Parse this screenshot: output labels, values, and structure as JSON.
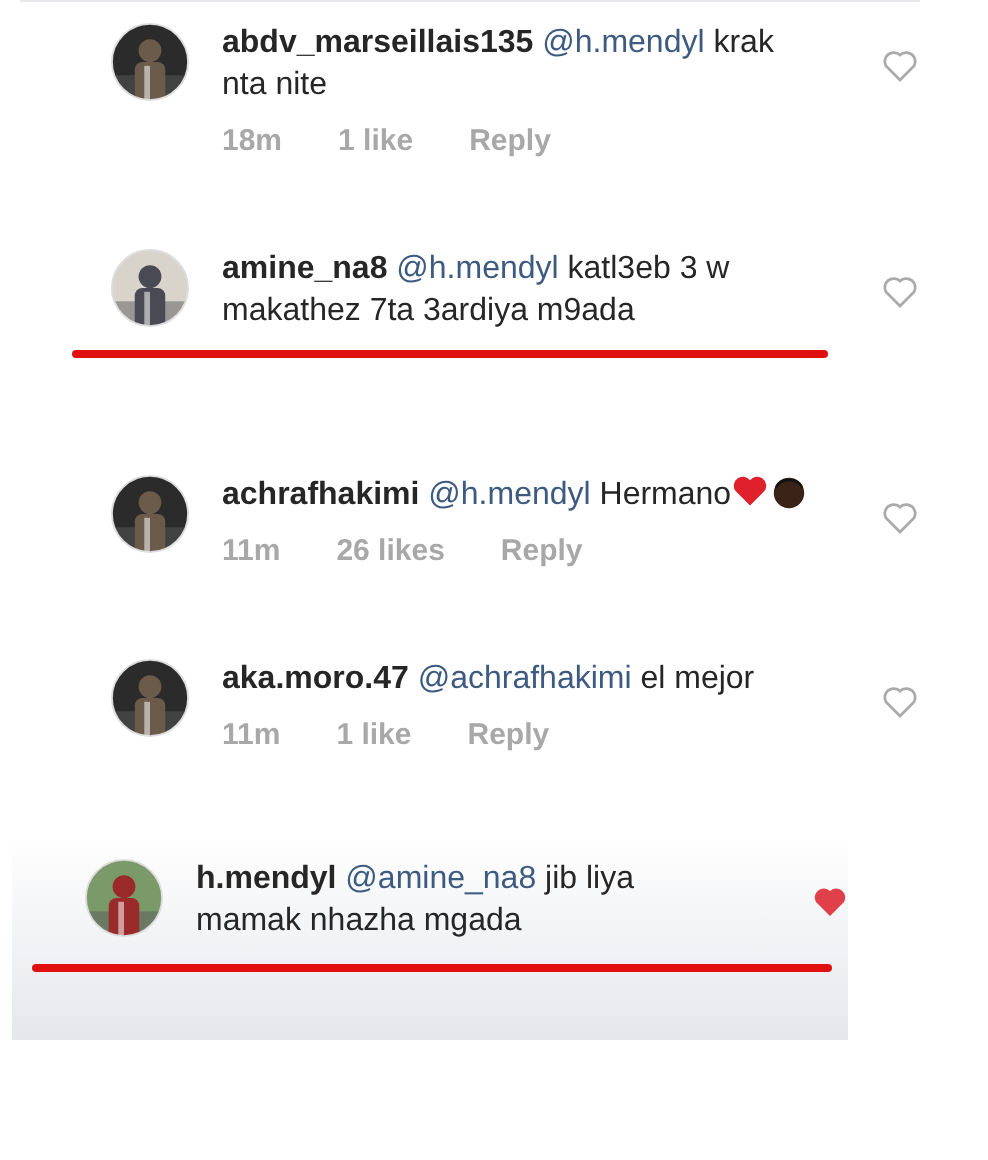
{
  "comments": [
    {
      "user": "abdv_marseillais135",
      "mention": "@h.mendyl",
      "text": "krak nta nite",
      "time": "18m",
      "likes": "1 like",
      "reply": "Reply",
      "liked": false,
      "highlighted": false,
      "marked": false
    },
    {
      "user": "amine_na8",
      "mention": "@h.mendyl",
      "text": "katl3eb 3 w makathez 7ta 3ardiya m9ada",
      "liked": false,
      "highlighted": false,
      "marked": true
    },
    {
      "user": "achrafhakimi",
      "mention": "@h.mendyl",
      "text": "Hermano",
      "emoji": [
        {
          "kind": "heart"
        },
        {
          "kind": "face"
        }
      ],
      "time": "11m",
      "likes": "26 likes",
      "reply": "Reply",
      "liked": false,
      "highlighted": false,
      "marked": false
    },
    {
      "user": "aka.moro.47",
      "mention": "@achrafhakimi",
      "text": "el mejor",
      "time": "11m",
      "likes": "1 like",
      "reply": "Reply",
      "liked": false,
      "highlighted": false,
      "marked": false
    },
    {
      "user": "h.mendyl",
      "mention": "@amine_na8",
      "text": "jib liya mamak nhazha mgada",
      "liked": true,
      "highlighted": true,
      "marked": true
    }
  ]
}
